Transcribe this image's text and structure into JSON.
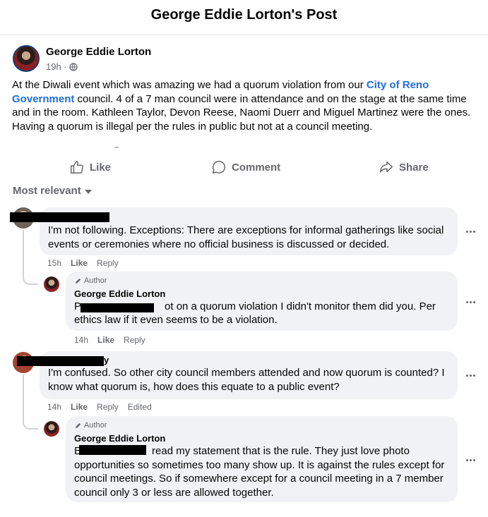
{
  "header": {
    "title": "George Eddie Lorton's Post"
  },
  "post": {
    "author": "George Eddie Lorton",
    "time": "19h ·",
    "text_before": "At the Diwali event which was amazing we had a quorum violation from our ",
    "link_text": "City of Reno Government",
    "text_after": " council. 4 of a 7 man council were in attendance and on the stage at the same time and in the room. Kathleen Taylor, Devon Reese, Naomi Duerr and Miguel Martinez were the ones. Having a quorum is illegal per the rules in public but not at a council meeting."
  },
  "actions": {
    "like": "Like",
    "comment": "Comment",
    "share": "Share"
  },
  "sort": {
    "label": "Most relevant"
  },
  "comments": [
    {
      "text": "I'm not following. Exceptions: There are exceptions for informal gatherings like social events or ceremonies where no official business is discussed or decided.",
      "time": "15h",
      "like": "Like",
      "reply": "Reply",
      "reply_item": {
        "badge": "Author",
        "name": "George Eddie Lorton",
        "text_prefix": "P",
        "text": "ot on a quorum violation I didn't monitor them did you. Per ethics law if it even seems to be a violation.",
        "time": "14h",
        "like": "Like",
        "reply": "Reply"
      }
    },
    {
      "name_tail": "y",
      "text": "I'm confused. So other city council members attended and now quorum is counted? I know what quorum is, how does this equate to a public event?",
      "time": "14h",
      "like": "Like",
      "reply": "Reply",
      "edited": "Edited",
      "reply_item": {
        "badge": "Author",
        "name": "George Eddie Lorton",
        "text_prefix": "E",
        "text": "read my statement that is the rule. They just love photo opportunities so sometimes too many show up. It is against the rules except for council meetings. So if somewhere except for a council meeting in a 7 member council only 3 or less are allowed together."
      }
    }
  ]
}
